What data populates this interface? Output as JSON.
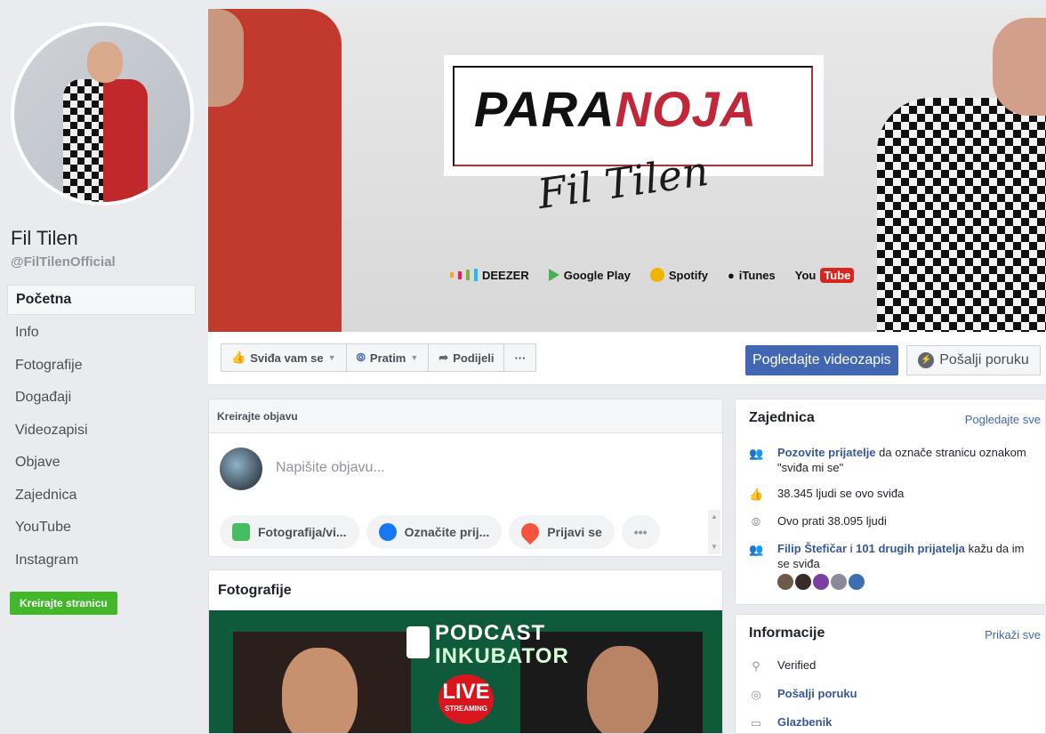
{
  "profile": {
    "name": "Fil Tilen",
    "handle": "@FilTilenOfficial"
  },
  "nav": [
    {
      "label": "Početna",
      "active": true
    },
    {
      "label": "Info"
    },
    {
      "label": "Fotografije"
    },
    {
      "label": "Događaji"
    },
    {
      "label": "Videozapisi"
    },
    {
      "label": "Objave"
    },
    {
      "label": "Zajednica"
    },
    {
      "label": "YouTube"
    },
    {
      "label": "Instagram"
    }
  ],
  "create_page_label": "Kreirajte stranicu",
  "cover": {
    "logo_part1": "PARA",
    "logo_part2": "NOJA",
    "signature": "Fil Tilen",
    "stores": {
      "deezer": "DEEZER",
      "google_play": "Google Play",
      "spotify": "Spotify",
      "itunes": "iTunes",
      "youtube_you": "You",
      "youtube_tube": "Tube"
    }
  },
  "actions": {
    "like": "Sviđa vam se",
    "follow": "Pratim",
    "share": "Podijeli",
    "more": "···",
    "watch": "Pogledajte videozapis",
    "message": "Pošalji poruku"
  },
  "composer": {
    "title": "Kreirajte objavu",
    "placeholder": "Napišite objavu...",
    "actions": [
      "Fotografija/vi...",
      "Označite prij...",
      "Prijavi se",
      "•••"
    ]
  },
  "photos": {
    "title": "Fotografije",
    "podcast_l1": "PODCAST",
    "podcast_l2": "INKUBATOR",
    "live": "LIVE",
    "streaming": "STREAMING"
  },
  "community": {
    "title": "Zajednica",
    "link": "Pogledajte sve",
    "invite_link": "Pozovite prijatelje",
    "invite_rest": " da označe stranicu oznakom \"sviđa mi se\"",
    "likes": "38.345 ljudi se ovo sviđa",
    "follows": "Ovo prati 38.095 ljudi",
    "friend": "Filip Štefičar",
    "and": " i ",
    "others": "101 drugih prijatelja",
    "friends_rest": " kažu da im se sviđa"
  },
  "info": {
    "title": "Informacije",
    "link": "Prikaži sve",
    "verified": "Verified",
    "message": "Pošalji poruku",
    "category": "Glazbenik"
  },
  "colors": {
    "brand_blue": "#4267b2",
    "green": "#42b72a",
    "link": "#365899"
  }
}
